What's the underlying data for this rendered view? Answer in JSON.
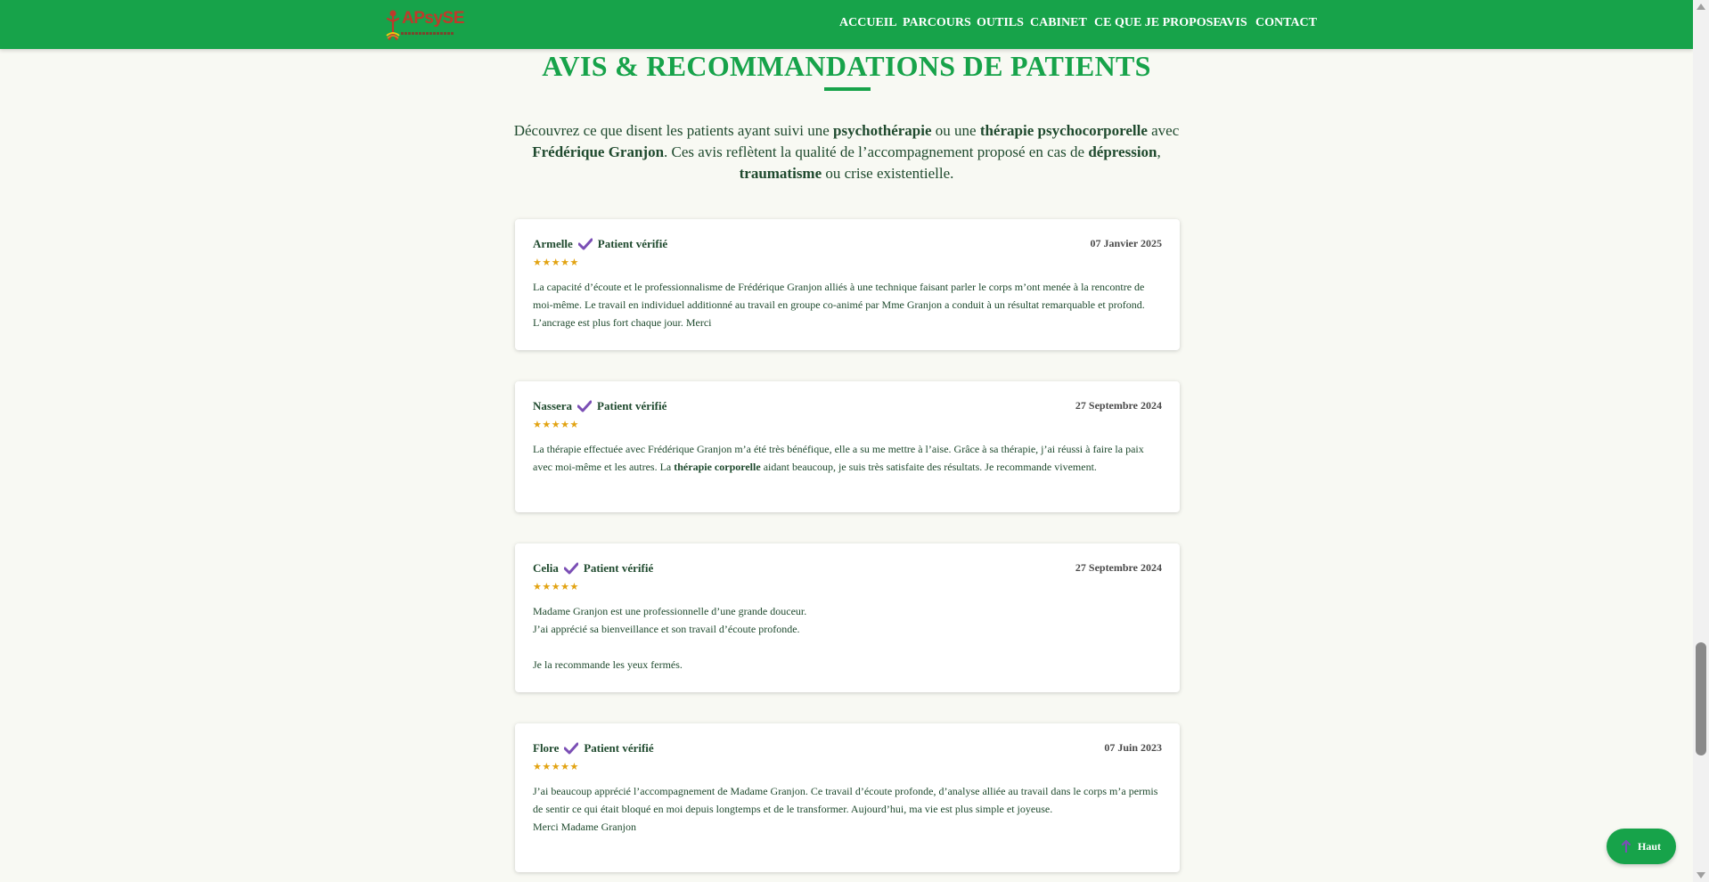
{
  "header": {
    "logo_text": "APsySE",
    "nav": [
      "ACCUEIL",
      "PARCOURS",
      "OUTILS",
      "CABINET",
      "CE QUE JE PROPOSE",
      "AVIS",
      "CONTACT"
    ]
  },
  "main": {
    "title": "AVIS & RECOMMANDATIONS DE PATIENTS",
    "intro": {
      "p1": "Découvrez ce que disent les patients ayant suivi une ",
      "b1": "psychothérapie",
      "p2": " ou une ",
      "b2": "thérapie psychocorporelle",
      "p3": " avec ",
      "b3": "Frédérique Granjon",
      "p4": ". Ces avis reflètent la qualité de l’accompagnement proposé en cas de ",
      "b4": "dépression",
      "p5": ", ",
      "b5": "traumatisme",
      "p6": " ou crise existentielle."
    },
    "verified_label": "Patient vérifié",
    "stars": "★★★★★",
    "reviews": [
      {
        "name": "Armelle",
        "date": "07 Janvier 2025",
        "rating": 5,
        "text": "La capacité d’écoute et le professionnalisme de Frédérique Granjon alliés à une technique faisant parler le corps m’ont menée à la rencontre de moi-même. Le travail en individuel additionné au travail en groupe co-animé par Mme Granjon a conduit à un résultat remarquable et profond. L’ancrage est plus fort chaque jour. Merci"
      },
      {
        "name": "Nassera",
        "date": "27 Septembre 2024",
        "rating": 5,
        "text_a": "La thérapie effectuée avec Frédérique Granjon m’a été très bénéfique, elle a su me mettre à l’aise. Grâce à sa thérapie, j’ai réussi à faire la paix avec moi-même et les autres. La ",
        "text_b": "thérapie corporelle",
        "text_c": " aidant beaucoup, je suis très satisfaite des résultats. Je recommande vivement."
      },
      {
        "name": "Celia",
        "date": "27 Septembre 2024",
        "rating": 5,
        "line1": "Madame Granjon est une professionnelle d’une grande douceur.",
        "line2": "J’ai apprécié sa bienveillance et son travail d’écoute profonde.",
        "line3": "Je la recommande les yeux fermés."
      },
      {
        "name": "Flore",
        "date": "07 Juin 2023",
        "rating": 5,
        "line1": "J’ai beaucoup apprécié l’accompagnement de Madame Granjon. Ce travail d’écoute profonde, d’analyse alliée au travail dans le corps m’a permis de sentir ce qui était bloqué en moi depuis longtemps et de le transformer. Aujourd’hui, ma vie est plus simple et joyeuse.",
        "line2": "Merci Madame Granjon"
      }
    ]
  },
  "back_to_top": {
    "label": "Haut"
  },
  "colors": {
    "brand_green": "#17a34a",
    "text_green": "#1f4a2e",
    "star": "#e2a312",
    "check": "#7b4fb5"
  }
}
